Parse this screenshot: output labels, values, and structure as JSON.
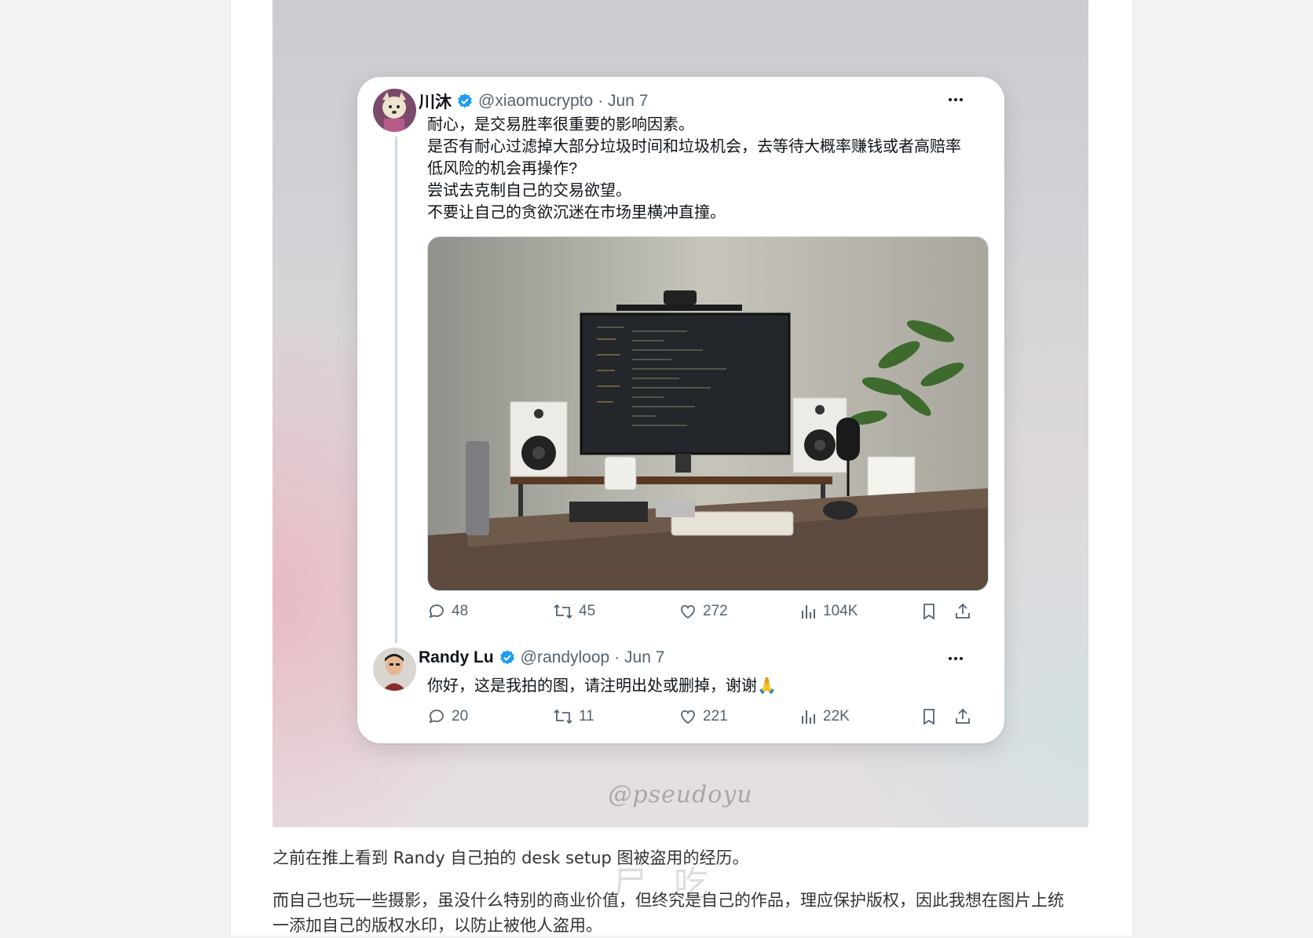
{
  "hero": {
    "watermark": "@pseudoyu"
  },
  "tweet": {
    "display_name": "川沐",
    "handle": "@xiaomucrypto",
    "date": "· Jun 7",
    "lines": [
      "耐心，是交易胜率很重要的影响因素。",
      "是否有耐心过滤掉大部分垃圾时间和垃圾机会，去等待大概率赚钱或者高赔率",
      "低风险的机会再操作?",
      "尝试去克制自己的交易欲望。",
      "不要让自己的贪欲沉迷在市场里横冲直撞。"
    ],
    "stats": {
      "replies": "48",
      "reposts": "45",
      "likes": "272",
      "views": "104K"
    }
  },
  "reply": {
    "display_name": "Randy Lu",
    "handle": "@randyloop",
    "date": "· Jun 7",
    "text": "你好，这是我拍的图，请注明出处或删掉，谢谢🙏",
    "stats": {
      "replies": "20",
      "reposts": "11",
      "likes": "221",
      "views": "22K"
    }
  },
  "article": {
    "paragraph1": "之前在推上看到 Randy 自己拍的 desk setup 图被盗用的经历。",
    "paragraph2_line1": "而自己也玩一些摄影，虽没什么特别的商业价值，但终究是自己的作品，理应保护版权，因此我想在图片上统",
    "paragraph2_line2": "一添加自己的版权水印，以防止被他人盗用。",
    "overlay_mark": "尸 吃"
  },
  "colors": {
    "verified": "#1d9bf0",
    "icon_gray": "#536471",
    "text": "#0f1419"
  },
  "icons": [
    "verified-badge-icon",
    "more-icon",
    "reply-icon",
    "repost-icon",
    "like-icon",
    "views-icon",
    "bookmark-icon",
    "share-icon"
  ]
}
